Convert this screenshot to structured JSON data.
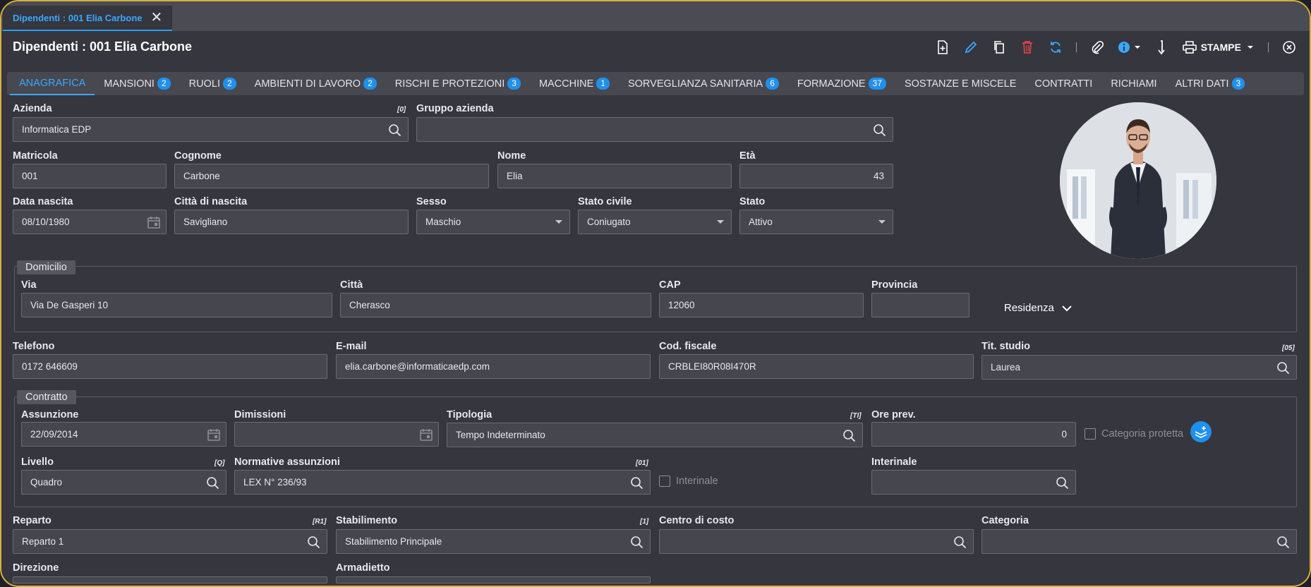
{
  "window": {
    "tab_title": "Dipendenti : 001 Elia Carbone"
  },
  "header": {
    "title": "Dipendenti : 001 Elia Carbone",
    "stampe_label": "STAMPE"
  },
  "tabs": [
    {
      "label": "ANAGRAFICA",
      "badge": ""
    },
    {
      "label": "MANSIONI",
      "badge": "2"
    },
    {
      "label": "RUOLI",
      "badge": "2"
    },
    {
      "label": "AMBIENTI DI LAVORO",
      "badge": "2"
    },
    {
      "label": "RISCHI E PROTEZIONI",
      "badge": "3"
    },
    {
      "label": "MACCHINE",
      "badge": "1"
    },
    {
      "label": "SORVEGLIANZA SANITARIA",
      "badge": "6"
    },
    {
      "label": "FORMAZIONE",
      "badge": "37"
    },
    {
      "label": "SOSTANZE E MISCELE",
      "badge": ""
    },
    {
      "label": "CONTRATTI",
      "badge": ""
    },
    {
      "label": "RICHIAMI",
      "badge": ""
    },
    {
      "label": "ALTRI DATI",
      "badge": "3"
    }
  ],
  "form": {
    "azienda": {
      "label": "Azienda",
      "code": "[0]",
      "value": "Informatica EDP"
    },
    "gruppo_azienda": {
      "label": "Gruppo azienda",
      "value": ""
    },
    "matricola": {
      "label": "Matricola",
      "value": "001"
    },
    "cognome": {
      "label": "Cognome",
      "value": "Carbone"
    },
    "nome": {
      "label": "Nome",
      "value": "Elia"
    },
    "eta": {
      "label": "Età",
      "value": "43"
    },
    "data_nascita": {
      "label": "Data nascita",
      "value": "08/10/1980"
    },
    "citta_nascita": {
      "label": "Città di nascita",
      "value": "Savigliano"
    },
    "sesso": {
      "label": "Sesso",
      "value": "Maschio"
    },
    "stato_civile": {
      "label": "Stato civile",
      "value": "Coniugato"
    },
    "stato": {
      "label": "Stato",
      "value": "Attivo"
    },
    "domicilio": {
      "legend": "Domicilio",
      "via": {
        "label": "Via",
        "value": "Via De Gasperi 10"
      },
      "citta": {
        "label": "Città",
        "value": "Cherasco"
      },
      "cap": {
        "label": "CAP",
        "value": "12060"
      },
      "provincia": {
        "label": "Provincia",
        "value": ""
      },
      "residenza_label": "Residenza"
    },
    "telefono": {
      "label": "Telefono",
      "value": "0172 646609"
    },
    "email": {
      "label": "E-mail",
      "value": "elia.carbone@informaticaedp.com"
    },
    "cod_fiscale": {
      "label": "Cod. fiscale",
      "value": "CRBLEI80R08I470R"
    },
    "tit_studio": {
      "label": "Tit. studio",
      "code": "[05]",
      "value": "Laurea"
    },
    "contratto": {
      "legend": "Contratto",
      "assunzione": {
        "label": "Assunzione",
        "value": "22/09/2014"
      },
      "dimissioni": {
        "label": "Dimissioni",
        "value": ""
      },
      "tipologia": {
        "label": "Tipologia",
        "code": "[TI]",
        "value": "Tempo Indeterminato"
      },
      "ore_prev": {
        "label": "Ore prev.",
        "value": "0"
      },
      "categoria_protetta": {
        "label": "Categoria protetta",
        "checked": false
      },
      "livello": {
        "label": "Livello",
        "code": "[Q]",
        "value": "Quadro"
      },
      "normative": {
        "label": "Normative assunzioni",
        "code": "[01]",
        "value": "LEX N° 236/93"
      },
      "interinale_chk": {
        "label": "Interinale",
        "checked": false
      },
      "interinale": {
        "label": "Interinale",
        "value": ""
      }
    },
    "reparto": {
      "label": "Reparto",
      "code": "[R1]",
      "value": "Reparto 1"
    },
    "stabilimento": {
      "label": "Stabilimento",
      "code": "[1]",
      "value": "Stabilimento Principale"
    },
    "centro_costo": {
      "label": "Centro di costo",
      "value": ""
    },
    "categoria": {
      "label": "Categoria",
      "value": ""
    },
    "direzione": {
      "label": "Direzione"
    },
    "armadietto": {
      "label": "Armadietto"
    }
  },
  "colors": {
    "accent": "#39a8ff",
    "badge": "#1f90ec",
    "delete": "#e0434b",
    "frame": "#d6b13c"
  },
  "icons": [
    "new-document-icon",
    "edit-pencil-icon",
    "copy-icon",
    "delete-trash-icon",
    "refresh-icon",
    "attachment-paperclip-icon",
    "info-icon",
    "sort-arrow-icon",
    "printer-icon",
    "close-circle-icon",
    "search-icon",
    "calendar-icon",
    "chevron-down-icon",
    "add-layers-icon"
  ]
}
